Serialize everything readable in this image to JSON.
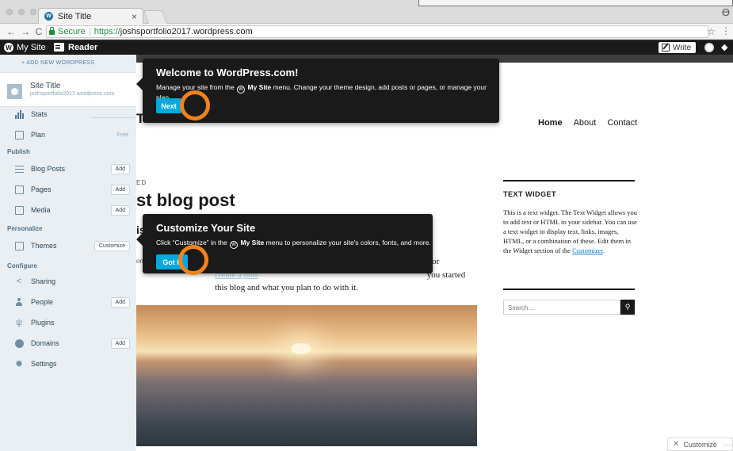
{
  "browser": {
    "tab_title": "Site Title",
    "tab_close": "×",
    "secure_label": "Secure",
    "url_scheme": "https://",
    "url_host": "joshsportfolio2017.wordpress.com",
    "icons": [
      "back-arrow-icon",
      "forward-arrow-icon",
      "reload-icon",
      "lock-icon",
      "star-icon",
      "menu-icon"
    ]
  },
  "masterbar": {
    "my_site": "My Site",
    "reader": "Reader",
    "write": "Write"
  },
  "sidebar": {
    "add_new": "+ ADD NEW WORDPRESS",
    "site_name": "Site Title",
    "site_url": "joshsportfolio2017.wordpress.com",
    "items": [
      {
        "label": "Stats"
      },
      {
        "label": "Plan",
        "badge": "Free"
      },
      {
        "label": "Blog Posts",
        "button": "Add"
      },
      {
        "label": "Pages",
        "button": "Add"
      },
      {
        "label": "Media",
        "button": "Add"
      },
      {
        "label": "Themes",
        "button": "Customize"
      },
      {
        "label": "Sharing"
      },
      {
        "label": "People",
        "button": "Add"
      },
      {
        "label": "Plugins"
      },
      {
        "label": "Domains",
        "button": "Add"
      },
      {
        "label": "Settings"
      }
    ],
    "groups": {
      "publish": "Publish",
      "personalize": "Personalize",
      "configure": "Configure"
    }
  },
  "site": {
    "title_fragment": "Title",
    "nav": [
      "Home",
      "About",
      "Contact"
    ],
    "post_meta_fragment": "ED",
    "post_title_fragment": "st blog post",
    "post_sub_fragment": "is",
    "comments_fragment": "omm",
    "post_text_1": "ete it, or",
    "post_text_2_link": "create a post",
    "post_text_2": "you started",
    "post_text_3": "this blog and what you plan to do with it.",
    "widget_title": "TEXT WIDGET",
    "widget_text": "This is a text widget. The Text Widget allows you to add text or HTML to your sidebar. You can use a text widget to display text, links, images, HTML, or a combination of these. Edit them in the Widget section of the",
    "widget_link": "Customizer",
    "widget_end": ".",
    "search_placeholder": "Search ...",
    "customize_float": "Customize",
    "customize_dots": "···"
  },
  "tooltips": {
    "welcome": {
      "title": "Welcome to WordPress.com!",
      "body_pre": "Manage your site from the",
      "body_bold": "My Site",
      "body_post": "menu. Change your theme design, add posts or pages, or manage your plan.",
      "button": "Next"
    },
    "customize": {
      "title": "Customize Your Site",
      "body_pre": "Click “Customize” in the",
      "body_bold": "My Site",
      "body_post": "menu to personalize your site's colors, fonts, and more.",
      "button": "Got it"
    }
  },
  "colors": {
    "accent": "#00aadc",
    "highlight_ring": "#f0821e",
    "masterbar": "#1a1a1a",
    "sidebar": "#e9eff3"
  }
}
